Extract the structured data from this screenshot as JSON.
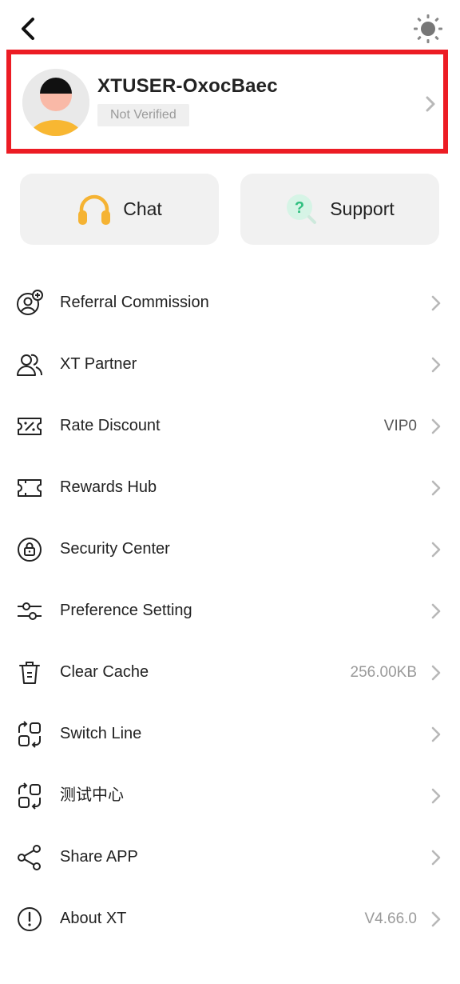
{
  "header": {
    "back_icon": "back-arrow-icon",
    "theme_icon": "sun-icon"
  },
  "profile": {
    "username": "XTUSER-OxocBaec",
    "verification": "Not Verified"
  },
  "quick_actions": {
    "chat_label": "Chat",
    "chat_icon": "headphones-icon",
    "support_label": "Support",
    "support_icon": "help-search-icon"
  },
  "menu": {
    "items": [
      {
        "label": "Referral Commission",
        "value": "",
        "icon": "user-add-icon"
      },
      {
        "label": "XT Partner",
        "value": "",
        "icon": "users-icon"
      },
      {
        "label": "Rate Discount",
        "value": "VIP0",
        "icon": "discount-ticket-icon"
      },
      {
        "label": "Rewards Hub",
        "value": "",
        "icon": "ticket-icon"
      },
      {
        "label": "Security Center",
        "value": "",
        "icon": "lock-icon"
      },
      {
        "label": "Preference Setting",
        "value": "",
        "icon": "sliders-icon"
      },
      {
        "label": "Clear Cache",
        "value": "256.00KB",
        "icon": "trash-icon"
      },
      {
        "label": "Switch Line",
        "value": "",
        "icon": "switch-icon"
      },
      {
        "label": "测试中心",
        "value": "",
        "icon": "switch-icon"
      },
      {
        "label": "Share APP",
        "value": "",
        "icon": "share-icon"
      },
      {
        "label": "About XT",
        "value": "V4.66.0",
        "icon": "info-icon"
      }
    ]
  },
  "colors": {
    "highlight_border": "#ec1c24",
    "headphones": "#f5b333",
    "support_accent": "#2fbf7f"
  }
}
